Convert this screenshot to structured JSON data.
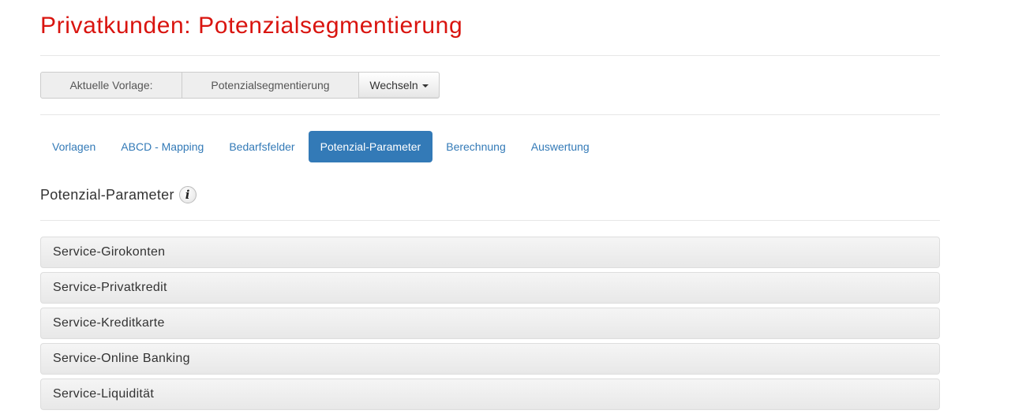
{
  "page": {
    "title": "Privatkunden: Potenzialsegmentierung"
  },
  "template_bar": {
    "label": "Aktuelle Vorlage:",
    "value": "Potenzialsegmentierung",
    "switch_label": "Wechseln"
  },
  "tabs": [
    {
      "label": "Vorlagen",
      "active": false
    },
    {
      "label": "ABCD - Mapping",
      "active": false
    },
    {
      "label": "Bedarfsfelder",
      "active": false
    },
    {
      "label": "Potenzial-Parameter",
      "active": true
    },
    {
      "label": "Berechnung",
      "active": false
    },
    {
      "label": "Auswertung",
      "active": false
    }
  ],
  "section": {
    "title": "Potenzial-Parameter",
    "info_icon": "info-icon",
    "info_glyph": "i"
  },
  "panels": [
    {
      "label": "Service-Girokonten"
    },
    {
      "label": "Service-Privatkredit"
    },
    {
      "label": "Service-Kreditkarte"
    },
    {
      "label": "Service-Online Banking"
    },
    {
      "label": "Service-Liquidität"
    }
  ],
  "colors": {
    "title_red": "#d9140f",
    "link_blue": "#337ab7",
    "active_tab_bg": "#337ab7"
  }
}
